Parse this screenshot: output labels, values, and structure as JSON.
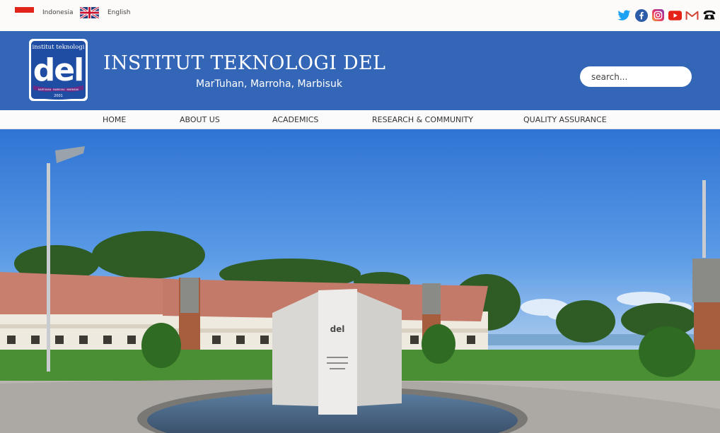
{
  "topbar": {
    "languages": [
      {
        "label": "Indonesia",
        "flag": "indonesia-flag"
      },
      {
        "label": "English",
        "flag": "uk-flag"
      }
    ],
    "social": [
      "twitter-icon",
      "facebook-icon",
      "instagram-icon",
      "youtube-icon",
      "gmail-icon",
      "phone-icon"
    ]
  },
  "header": {
    "logo": {
      "top_text": "institut teknologi",
      "main_text": "del",
      "band_text": "MARTUHAN · MARROHA · MARBISUK",
      "year": "2001"
    },
    "title": "INSTITUT TEKNOLOGI DEL",
    "tagline": "MarTuhan, Marroha, Marbisuk",
    "search_placeholder": "search..."
  },
  "nav": {
    "items": [
      {
        "label": "HOME"
      },
      {
        "label": "ABOUT US"
      },
      {
        "label": "ACADEMICS"
      },
      {
        "label": "RESEARCH & COMMUNITY"
      },
      {
        "label": "QUALITY ASSURANCE"
      }
    ]
  },
  "hero": {
    "monument_logo": "del"
  },
  "colors": {
    "header_bg": "#3366b7",
    "topbar_bg": "#fdfbf9",
    "nav_bg": "#fbfbfb"
  }
}
